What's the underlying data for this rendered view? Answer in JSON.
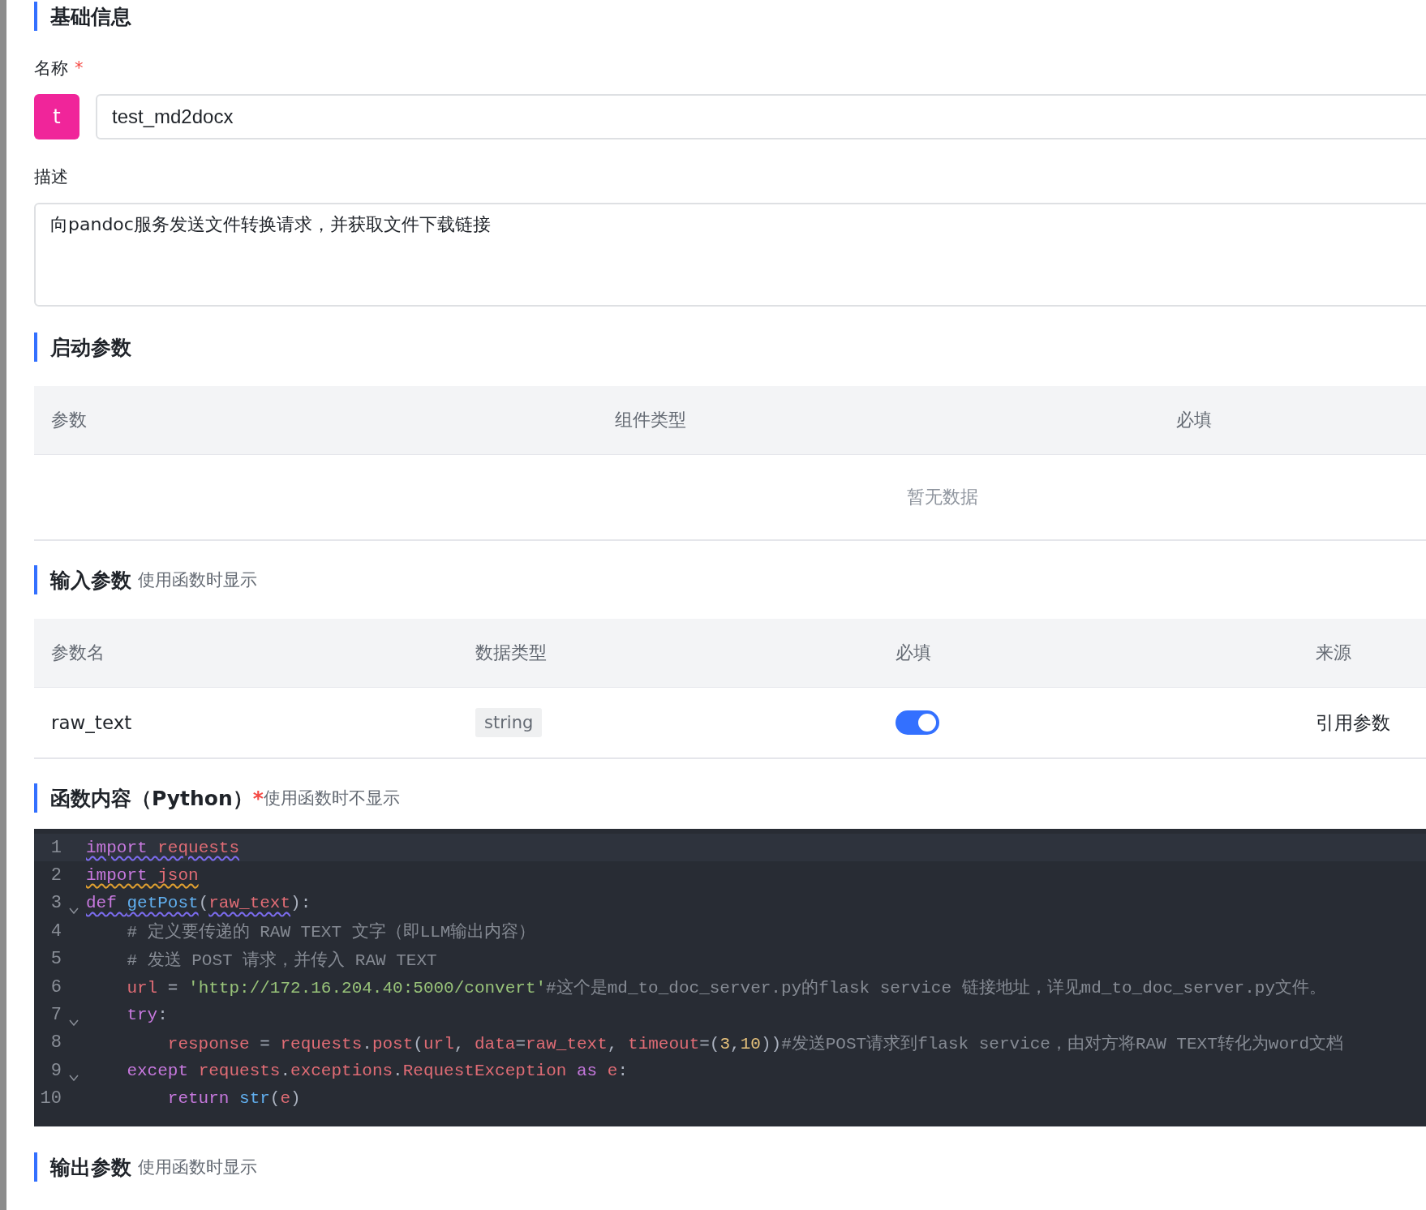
{
  "basic": {
    "title": "基础信息",
    "name_label": "名称",
    "required_mark": "*",
    "avatar_letter": "t",
    "name_value": "test_md2docx",
    "desc_label": "描述",
    "desc_value": "向pandoc服务发送文件转换请求，并获取文件下载链接"
  },
  "startup": {
    "title": "启动参数",
    "columns": [
      "参数",
      "组件类型",
      "必填"
    ],
    "empty_text": "暂无数据"
  },
  "inputs": {
    "title": "输入参数",
    "hint": "使用函数时显示",
    "columns": [
      "参数名",
      "数据类型",
      "必填",
      "来源"
    ],
    "rows": [
      {
        "name": "raw_text",
        "type": "string",
        "required": true,
        "source": "引用参数"
      }
    ]
  },
  "code": {
    "title": "函数内容（Python）",
    "required_mark": "*",
    "hint": "使用函数时不显示",
    "lines": [
      {
        "number": "1",
        "active": true,
        "fold": false,
        "color": "#7c6cf0",
        "tokens": [
          {
            "kind": "keyword",
            "text": "import "
          },
          {
            "kind": "name",
            "text": "requests"
          }
        ]
      },
      {
        "number": "2",
        "active": false,
        "fold": false,
        "color": "#e0a030",
        "tokens": [
          {
            "kind": "keyword",
            "text": "import "
          },
          {
            "kind": "name",
            "text": "json"
          }
        ]
      },
      {
        "number": "3",
        "active": false,
        "fold": true,
        "color": "#7c6cf0",
        "tokens": [
          {
            "kind": "keyword",
            "text": "def "
          },
          {
            "kind": "function",
            "text": "getPost"
          },
          {
            "kind": "plain",
            "text": "("
          },
          {
            "kind": "name",
            "text": "raw_text"
          },
          {
            "kind": "plain",
            "text": "):"
          }
        ]
      },
      {
        "number": "4",
        "active": false,
        "fold": false,
        "tokens": [
          {
            "kind": "comment",
            "text": "    # 定义要传递的 RAW TEXT 文字（即LLM输出内容）"
          }
        ]
      },
      {
        "number": "5",
        "active": false,
        "fold": false,
        "tokens": [
          {
            "kind": "comment",
            "text": "    # 发送 POST 请求，并传入 RAW TEXT"
          }
        ]
      },
      {
        "number": "6",
        "active": false,
        "fold": false,
        "tokens": [
          {
            "kind": "name",
            "text": "    url"
          },
          {
            "kind": "plain",
            "text": " = "
          },
          {
            "kind": "string",
            "text": "'http://172.16.204.40:5000/convert'"
          },
          {
            "kind": "comment",
            "text": "#这个是md_to_doc_server.py的flask service 链接地址，详见md_to_doc_server.py文件。"
          }
        ]
      },
      {
        "number": "7",
        "active": false,
        "fold": true,
        "tokens": [
          {
            "kind": "keyword",
            "text": "    try"
          },
          {
            "kind": "plain",
            "text": ":"
          }
        ]
      },
      {
        "number": "8",
        "active": false,
        "fold": false,
        "tokens": [
          {
            "kind": "name",
            "text": "        response"
          },
          {
            "kind": "plain",
            "text": " = "
          },
          {
            "kind": "name",
            "text": "requests"
          },
          {
            "kind": "plain",
            "text": "."
          },
          {
            "kind": "name",
            "text": "post"
          },
          {
            "kind": "plain",
            "text": "("
          },
          {
            "kind": "name",
            "text": "url"
          },
          {
            "kind": "plain",
            "text": ", "
          },
          {
            "kind": "name",
            "text": "data"
          },
          {
            "kind": "plain",
            "text": "="
          },
          {
            "kind": "name",
            "text": "raw_text"
          },
          {
            "kind": "plain",
            "text": ", "
          },
          {
            "kind": "name",
            "text": "timeout"
          },
          {
            "kind": "plain",
            "text": "=("
          },
          {
            "kind": "number",
            "text": "3"
          },
          {
            "kind": "plain",
            "text": ","
          },
          {
            "kind": "number",
            "text": "10"
          },
          {
            "kind": "plain",
            "text": "))"
          },
          {
            "kind": "comment",
            "text": "#发送POST请求到flask service，由对方将RAW TEXT转化为word文档"
          }
        ]
      },
      {
        "number": "9",
        "active": false,
        "fold": true,
        "tokens": [
          {
            "kind": "keyword",
            "text": "    except "
          },
          {
            "kind": "name",
            "text": "requests"
          },
          {
            "kind": "plain",
            "text": "."
          },
          {
            "kind": "name",
            "text": "exceptions"
          },
          {
            "kind": "plain",
            "text": "."
          },
          {
            "kind": "name",
            "text": "RequestException "
          },
          {
            "kind": "keyword",
            "text": "as "
          },
          {
            "kind": "name",
            "text": "e"
          },
          {
            "kind": "plain",
            "text": ":"
          }
        ]
      },
      {
        "number": "10",
        "active": false,
        "fold": false,
        "tokens": [
          {
            "kind": "keyword",
            "text": "        return "
          },
          {
            "kind": "builtin",
            "text": "str"
          },
          {
            "kind": "plain",
            "text": "("
          },
          {
            "kind": "name",
            "text": "e"
          },
          {
            "kind": "plain",
            "text": ")"
          }
        ]
      }
    ]
  },
  "outputs": {
    "title": "输出参数",
    "hint": "使用函数时显示"
  }
}
